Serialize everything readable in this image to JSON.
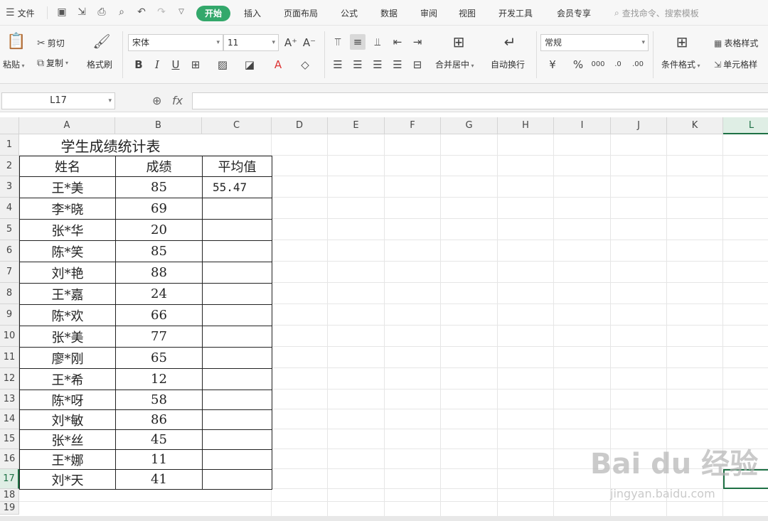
{
  "menu": {
    "file_label": "文件",
    "tabs": [
      "开始",
      "插入",
      "页面布局",
      "公式",
      "数据",
      "审阅",
      "视图",
      "开发工具",
      "会员专享"
    ],
    "search_placeholder": "查找命令、搜索模板"
  },
  "ribbon": {
    "paste_label": "粘贴",
    "cut_label": "剪切",
    "copy_label": "复制",
    "format_painter_label": "格式刷",
    "font_name": "宋体",
    "font_size": "11",
    "merge_center_label": "合并居中",
    "wrap_text_label": "自动换行",
    "number_format": "常规",
    "conditional_format_label": "条件格式",
    "table_style_label": "表格样式",
    "cell_style_label": "单元格样"
  },
  "formula_bar": {
    "name_box": "L17",
    "fx_label": "fx",
    "formula": ""
  },
  "sheet": {
    "columns": [
      "A",
      "B",
      "C",
      "D",
      "E",
      "F",
      "G",
      "H",
      "I",
      "J",
      "K",
      "L"
    ],
    "rows": [
      "1",
      "2",
      "3",
      "4",
      "5",
      "6",
      "7",
      "8",
      "9",
      "10",
      "11",
      "12",
      "13",
      "14",
      "15",
      "16",
      "17",
      "18",
      "19"
    ],
    "selected_column": "L",
    "selected_row": "17",
    "title": "学生成绩统计表",
    "headers": {
      "name": "姓名",
      "score": "成绩",
      "average": "平均值"
    },
    "average_value": "55.47",
    "students": [
      {
        "name": "王*美",
        "score": "85"
      },
      {
        "name": "李*晓",
        "score": "69"
      },
      {
        "name": "张*华",
        "score": "20"
      },
      {
        "name": "陈*笑",
        "score": "85"
      },
      {
        "name": "刘*艳",
        "score": "88"
      },
      {
        "name": "王*嘉",
        "score": "24"
      },
      {
        "name": "陈*欢",
        "score": "66"
      },
      {
        "name": "张*美",
        "score": "77"
      },
      {
        "name": "廖*刚",
        "score": "65"
      },
      {
        "name": "王*希",
        "score": "12"
      },
      {
        "name": "陈*呀",
        "score": "58"
      },
      {
        "name": "刘*敏",
        "score": "86"
      },
      {
        "name": "张*丝",
        "score": "45"
      },
      {
        "name": "王*娜",
        "score": "11"
      },
      {
        "name": "刘*天",
        "score": "41"
      }
    ]
  },
  "watermark": {
    "logo": "Bai du 经验",
    "url": "jingyan.baidu.com"
  },
  "colors": {
    "accent": "#33a86b",
    "selection": "#1e7145"
  }
}
